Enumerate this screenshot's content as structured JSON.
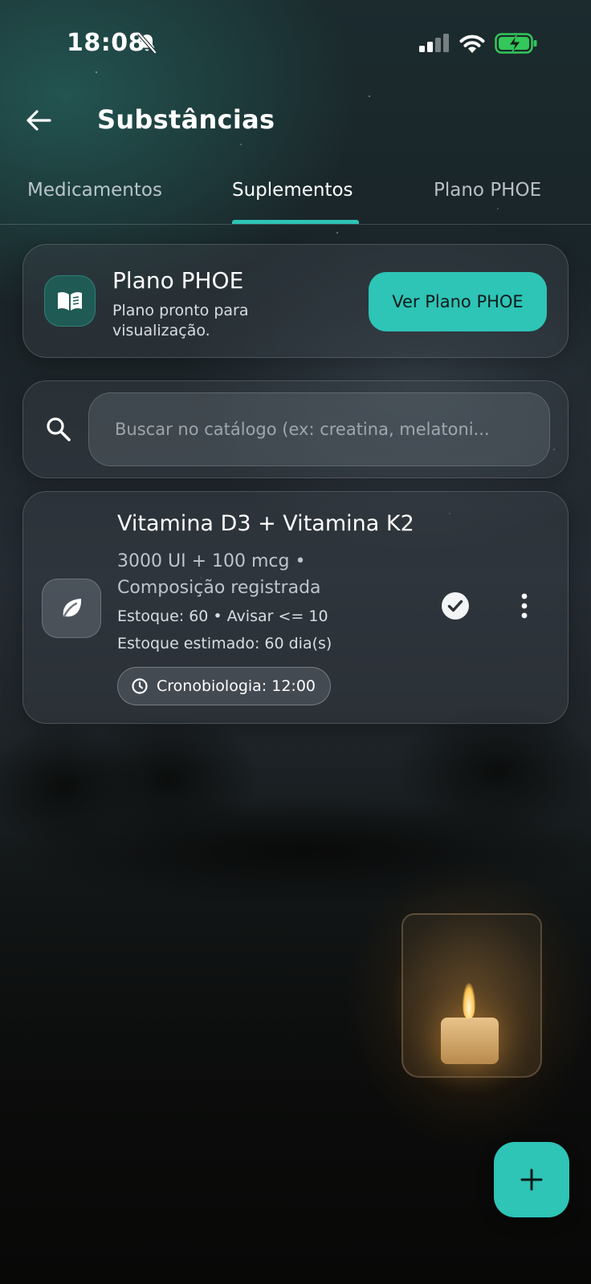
{
  "status_bar": {
    "time": "18:08",
    "icons": [
      "bell-off-icon",
      "signal-icon",
      "wifi-icon",
      "battery-charging-icon"
    ],
    "battery_color": "#34c759"
  },
  "header": {
    "title": "Substâncias",
    "back_icon": "arrow-left-icon"
  },
  "tabs": [
    {
      "label": "Medicamentos",
      "active": false
    },
    {
      "label": "Suplementos",
      "active": true
    },
    {
      "label": "Plano PHOE",
      "active": false
    }
  ],
  "plan_card": {
    "icon": "book-icon",
    "title": "Plano PHOE",
    "subtitle": "Plano pronto para visualização.",
    "button_label": "Ver Plano PHOE"
  },
  "search": {
    "icon": "search-icon",
    "placeholder": "Buscar no catálogo (ex: creatina, melatoni...",
    "value": ""
  },
  "items": [
    {
      "icon": "leaf-icon",
      "title": "Vitamina D3 + Vitamina K2",
      "dose": "3000 UI + 100 mcg • Composição registrada",
      "stock": "Estoque: 60 • Avisar <= 10",
      "estimate": "Estoque estimado: 60 dia(s)",
      "chrono": "Cronobiologia: 12:00",
      "status_icon": "check-circle-icon",
      "menu_icon": "more-vertical-icon"
    }
  ],
  "fab": {
    "icon": "plus-icon"
  },
  "colors": {
    "accent": "#2ec4b6",
    "text": "#ffffff"
  }
}
